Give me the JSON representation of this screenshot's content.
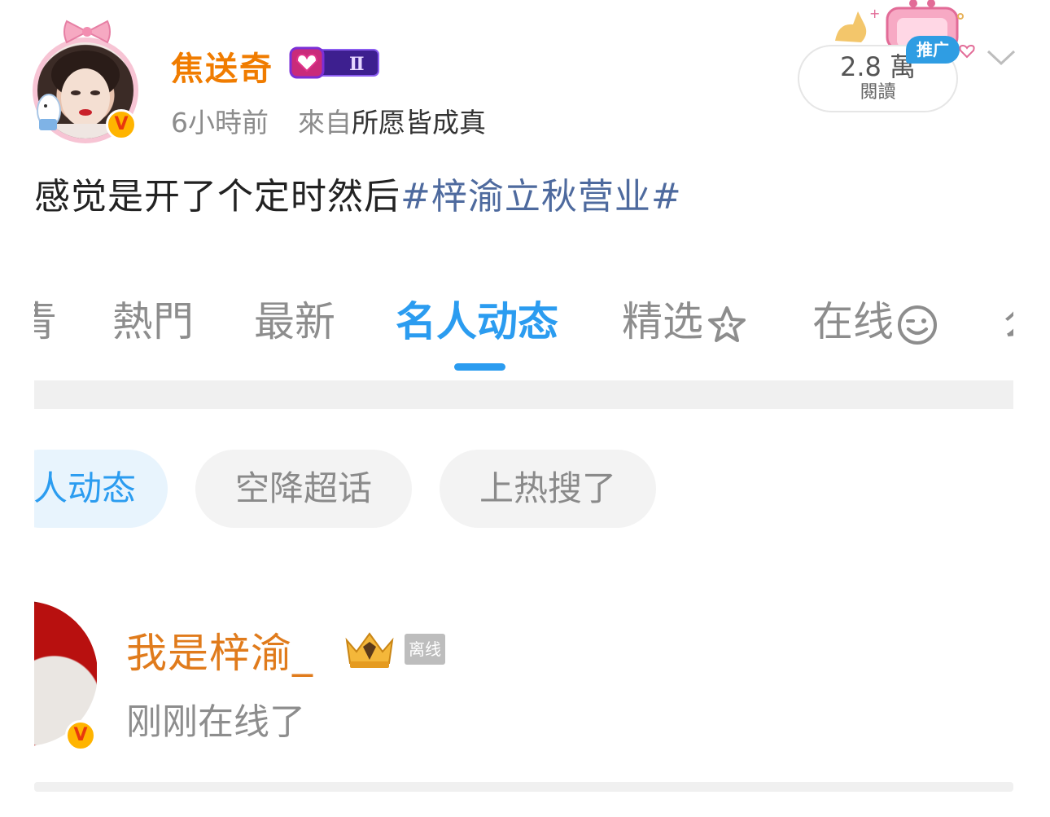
{
  "post": {
    "username": "焦送奇",
    "vip_level": "Ⅱ",
    "time": "6小時前",
    "source_prefix": "來自",
    "source_name": "所愿皆成真",
    "reads_count": "2.8 萬",
    "reads_label": "閱讀",
    "ad_tag": "推广",
    "text_before": "感觉是开了个定时然后",
    "hashtag": "#梓渝立秋营业#"
  },
  "tabs": [
    {
      "label": "青"
    },
    {
      "label": "熱門"
    },
    {
      "label": "最新"
    },
    {
      "label": "名人动态"
    },
    {
      "label": "精选"
    },
    {
      "label": "在线"
    },
    {
      "label": "么"
    }
  ],
  "chips": [
    {
      "label": "人动态"
    },
    {
      "label": "空降超话"
    },
    {
      "label": "上热搜了"
    }
  ],
  "celebrity": {
    "name": "我是梓渝_",
    "offline_tag": "离线",
    "status": "刚刚在线了",
    "verified": "V"
  },
  "colors": {
    "accent_blue": "#2b9cf0",
    "username_orange": "#f07c00",
    "hashtag_blue": "#4e6a9e"
  }
}
